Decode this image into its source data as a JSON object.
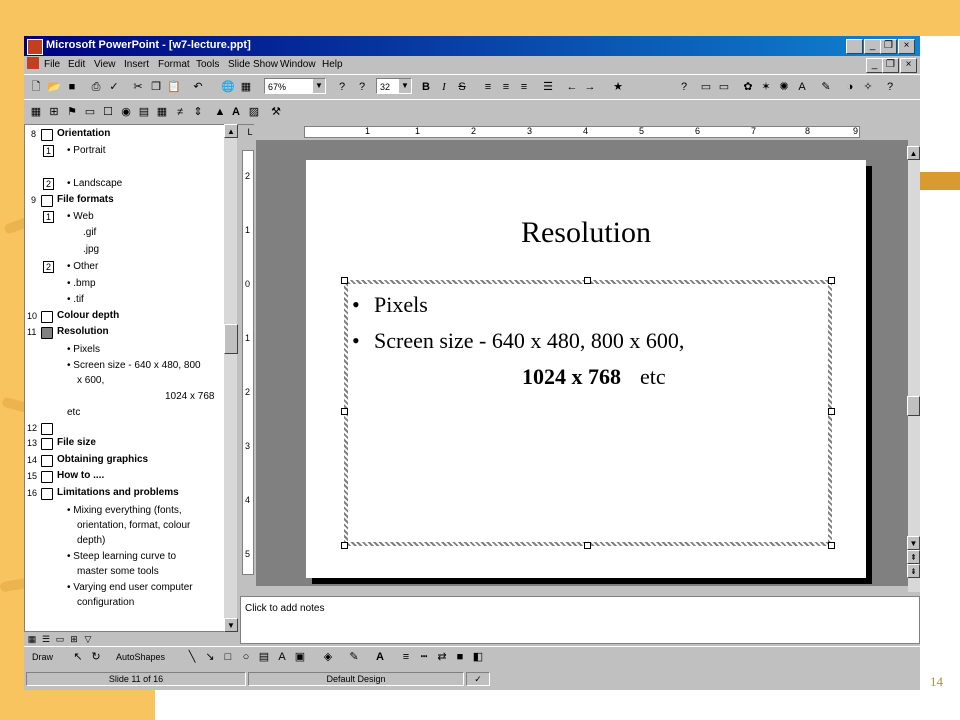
{
  "page_number": "14",
  "window": {
    "title": "Microsoft PowerPoint - [w7-lecture.ppt]"
  },
  "menubar": {
    "items": [
      "File",
      "Edit",
      "View",
      "Insert",
      "Format",
      "Tools",
      "Slide Show",
      "Window",
      "Help"
    ]
  },
  "toolbar": {
    "zoom": "67%",
    "font_size": "32"
  },
  "outline": {
    "items": [
      {
        "num": "8",
        "text": "Orientation"
      },
      {
        "num": "1",
        "text": "• Portrait"
      },
      {
        "num": "2",
        "text": "• Landscape"
      },
      {
        "num": "9",
        "text": "File formats"
      },
      {
        "num": "1",
        "text": "• Web"
      },
      {
        "text": ".gif"
      },
      {
        "text": ".jpg"
      },
      {
        "num": "2",
        "text": "• Other"
      },
      {
        "text": "• .bmp"
      },
      {
        "text": "• .tif"
      },
      {
        "num": "10",
        "text": "Colour depth"
      },
      {
        "num": "11",
        "text": "Resolution"
      },
      {
        "text": "• Pixels"
      },
      {
        "text": "• Screen size - 640 x 480, 800"
      },
      {
        "text": "x 600,"
      },
      {
        "text": "1024 x 768"
      },
      {
        "text": "etc"
      },
      {
        "num": "12",
        "text": ""
      },
      {
        "num": "13",
        "text": "File size"
      },
      {
        "num": "14",
        "text": "Obtaining graphics"
      },
      {
        "num": "15",
        "text": "How to ...."
      },
      {
        "num": "16",
        "text": "Limitations and problems"
      },
      {
        "text": "• Mixing everything (fonts,"
      },
      {
        "text": "orientation, format, colour"
      },
      {
        "text": "depth)"
      },
      {
        "text": "• Steep learning curve to"
      },
      {
        "text": "master some tools"
      },
      {
        "text": "• Varying end user computer"
      },
      {
        "text": "configuration"
      }
    ]
  },
  "ruler": {
    "h_labels": [
      "1",
      "1",
      "2",
      "3",
      "4",
      "5",
      "6",
      "7",
      "8",
      "9"
    ],
    "v_labels": [
      "2",
      "1",
      "0",
      "1",
      "2",
      "3",
      "4",
      "5"
    ]
  },
  "slide": {
    "title": "Resolution",
    "bullet1": "Pixels",
    "bullet2": "Screen size - 640 x 480, 800 x 600,",
    "bullet2_bold": "1024 x 768",
    "bullet2_tail": "etc",
    "bullet_char": "•"
  },
  "notes": {
    "placeholder": "Click to add notes"
  },
  "drawbar": {
    "draw": "Draw",
    "autoshapes": "AutoShapes"
  },
  "statusbar": {
    "slide": "Slide 11 of 16",
    "design": "Default Design"
  },
  "colors": {
    "title_bar": "#00007f",
    "background_accent": "#f8c460",
    "window_gray": "#c0c0c0"
  }
}
